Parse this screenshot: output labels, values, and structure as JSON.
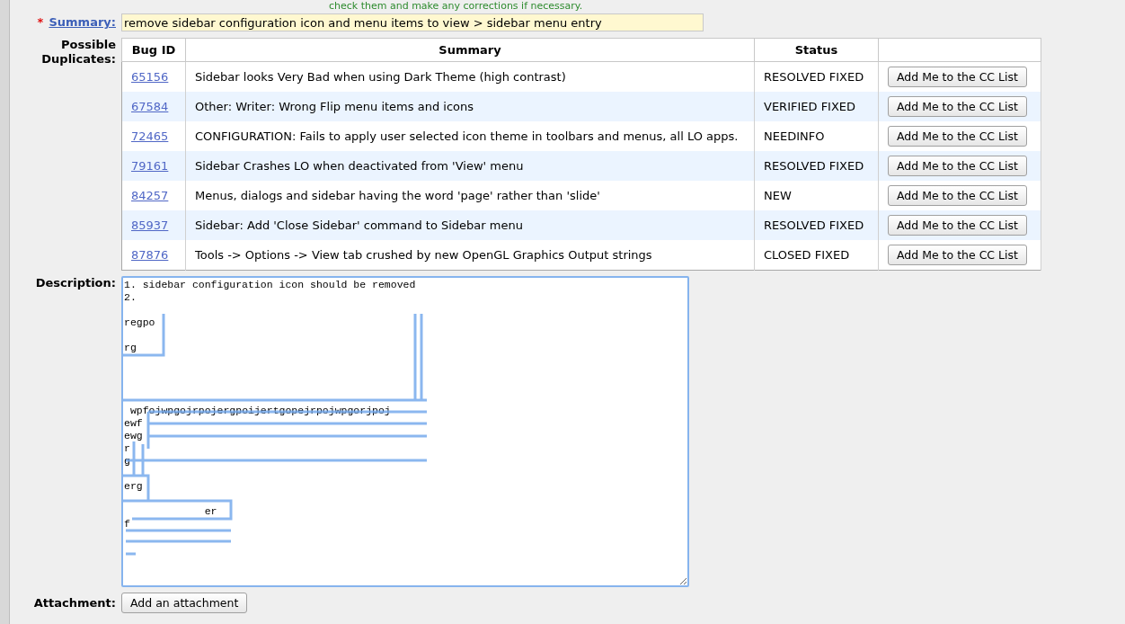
{
  "notice": "check them and make any corrections if necessary.",
  "summary": {
    "label": "Summary:",
    "required_mark": "*",
    "value": "remove sidebar configuration icon and menu items to view > sidebar menu entry"
  },
  "duplicates": {
    "label": "Possible Duplicates:",
    "columns": [
      "Bug ID",
      "Summary",
      "Status"
    ],
    "rows": [
      {
        "id": "65156",
        "summary": "Sidebar looks Very Bad when using Dark Theme (high contrast)",
        "status": "RESOLVED FIXED",
        "button": "Add Me to the CC List"
      },
      {
        "id": "67584",
        "summary": "Other: Writer: Wrong Flip menu items and icons",
        "status": "VERIFIED FIXED",
        "button": "Add Me to the CC List"
      },
      {
        "id": "72465",
        "summary": "CONFIGURATION: Fails to apply user selected icon theme in toolbars and menus, all LO apps.",
        "status": "NEEDINFO",
        "button": "Add Me to the CC List"
      },
      {
        "id": "79161",
        "summary": "Sidebar Crashes LO when deactivated from 'View' menu",
        "status": "RESOLVED FIXED",
        "button": "Add Me to the CC List"
      },
      {
        "id": "84257",
        "summary": "Menus, dialogs and sidebar having the word 'page' rather than 'slide'",
        "status": "NEW",
        "button": "Add Me to the CC List"
      },
      {
        "id": "85937",
        "summary": "Sidebar: Add 'Close Sidebar' command to Sidebar menu",
        "status": "RESOLVED FIXED",
        "button": "Add Me to the CC List"
      },
      {
        "id": "87876",
        "summary": "Tools -> Options -> View tab crushed by new OpenGL Graphics Output strings",
        "status": "CLOSED FIXED",
        "button": "Add Me to the CC List"
      }
    ]
  },
  "description": {
    "label": "Description:",
    "value": "1. sidebar configuration icon should be removed\n2.\n\nregpo\n\nrg\n\n\n\n\n wpfojwpgojrpojergpoijertgopejrpojwpgorjpoj\newf\newg\nr\ng\n\nerg\n\n             er\nf\n\n\n\n"
  },
  "attachment": {
    "label": "Attachment:",
    "button": "Add an attachment"
  }
}
